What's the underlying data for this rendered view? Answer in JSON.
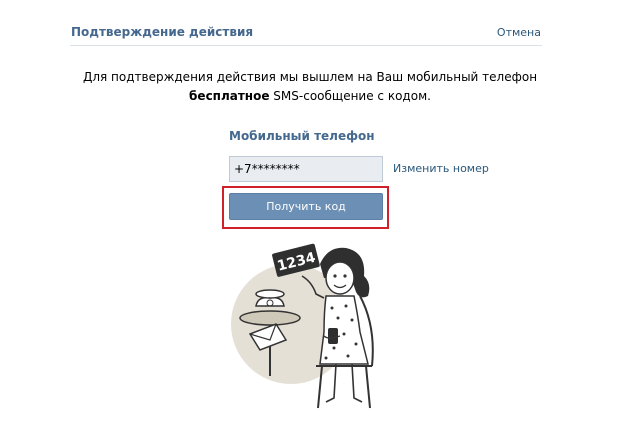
{
  "header": {
    "title": "Подтверждение действия",
    "cancel_label": "Отмена"
  },
  "message": {
    "line1": "Для подтверждения действия мы вышлем на Ваш мобильный телефон",
    "line2_bold": "бесплатное",
    "line2_rest": " SMS-сообщение с кодом."
  },
  "phone": {
    "label": "Мобильный телефон",
    "value": "+7********",
    "change_label": "Изменить номер"
  },
  "actions": {
    "get_code_label": "Получить код"
  },
  "illustration": {
    "sign_text": "1234"
  },
  "colors": {
    "accent": "#45688e",
    "button": "#6b8fb5",
    "highlight": "#d0202a",
    "link": "#2b587a"
  }
}
